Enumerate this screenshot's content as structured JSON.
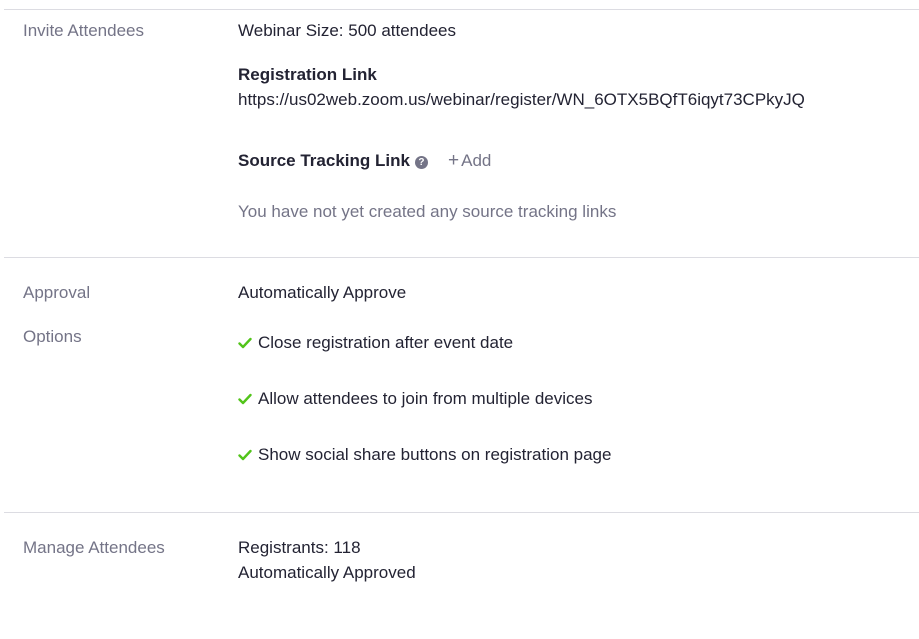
{
  "invite": {
    "label": "Invite Attendees",
    "webinar_size": "Webinar Size: 500 attendees",
    "registration_link_title": "Registration Link",
    "registration_link_url": "https://us02web.zoom.us/webinar/register/WN_6OTX5BQfT6iqyt73CPkyJQ",
    "source_tracking_title": "Source Tracking Link",
    "help_glyph": "?",
    "add_plus": "+",
    "add_label": "Add",
    "empty_text": "You have not yet created any source tracking links"
  },
  "approval": {
    "label": "Approval",
    "value": "Automatically Approve"
  },
  "options": {
    "label": "Options",
    "items": [
      "Close registration after event date",
      "Allow attendees to join from multiple devices",
      "Show social share buttons on registration page"
    ],
    "check_color": "#52c41a"
  },
  "manage": {
    "label": "Manage Attendees",
    "registrants": "Registrants: 118",
    "approval_status": "Automatically Approved"
  },
  "colors": {
    "text": "#232333",
    "muted": "#747487",
    "divider": "#dcdce2"
  }
}
